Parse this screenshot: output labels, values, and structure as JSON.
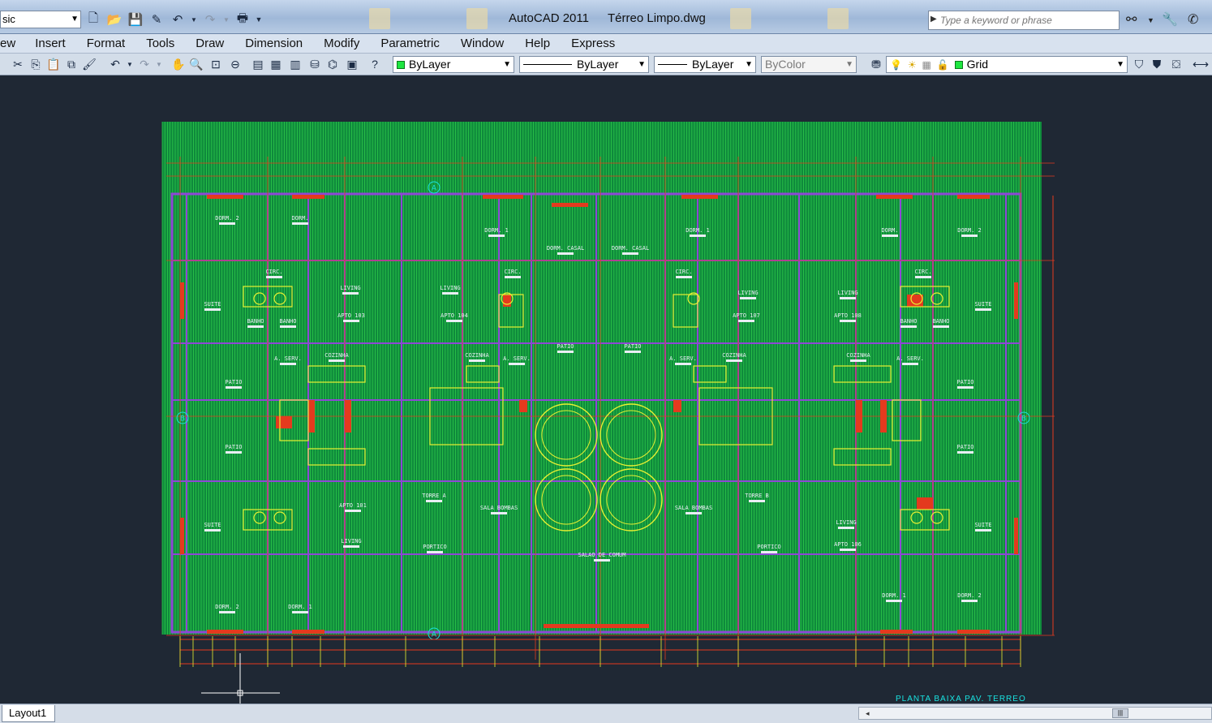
{
  "window": {
    "app_title": "AutoCAD 2011",
    "file_title": "Térreo Limpo.dwg",
    "workspace_value": "sic"
  },
  "search": {
    "placeholder": "Type a keyword or phrase"
  },
  "menu": [
    "ew",
    "Insert",
    "Format",
    "Tools",
    "Draw",
    "Dimension",
    "Modify",
    "Parametric",
    "Window",
    "Help",
    "Express"
  ],
  "toolbar": {
    "color_value": "ByLayer",
    "linetype_value": "ByLayer",
    "lineweight_value": "ByLayer",
    "plotstyle_value": "ByColor",
    "layer_value": "Grid"
  },
  "drawing": {
    "plan_title": "PLANTA BAIXA PAV. TERREO",
    "room_labels": [
      "DORM. 2",
      "DORM.",
      "DORM. 1",
      "DORM. CASAL",
      "DORM. CASAL",
      "DORM. 1",
      "DORM.",
      "DORM. 2",
      "CIRC.",
      "CIRC.",
      "CIRC.",
      "CIRC.",
      "SUITE",
      "LIVING",
      "LIVING",
      "LIVING",
      "LIVING",
      "SUITE",
      "APTO 103",
      "APTO 104",
      "APTO 107",
      "APTO 108",
      "BANHO",
      "BANHO",
      "BANHO",
      "BANHO",
      "A. SERV.",
      "COZINHA",
      "COZINHA",
      "A. SERV.",
      "A. SERV.",
      "COZINHA",
      "COZINHA",
      "A. SERV.",
      "PATIO",
      "PATIO",
      "PATIO",
      "PATIO",
      "PATIO",
      "PATIO",
      "TORRE A",
      "TORRE B",
      "SALA BOMBAS",
      "SALA BOMBAS",
      "SUITE",
      "APTO 101",
      "LIVING",
      "APTO 106",
      "LIVING",
      "SUITE",
      "PORTICO",
      "PORTICO",
      "SALAO DE COMUM",
      "DORM. 2",
      "DORM. 1",
      "DORM. 1",
      "DORM. 2"
    ],
    "axis_markers": [
      "A",
      "A",
      "B",
      "B"
    ],
    "colors": {
      "hatch": "#0f8a3c",
      "hatch_line": "#2cc84a",
      "wall": "#8e47d6",
      "yellow": "#e8f032",
      "red": "#e43a1e",
      "cyan": "#19e2e0",
      "background": "#1f2834"
    }
  },
  "status": {
    "layout_tab": "Layout1"
  }
}
